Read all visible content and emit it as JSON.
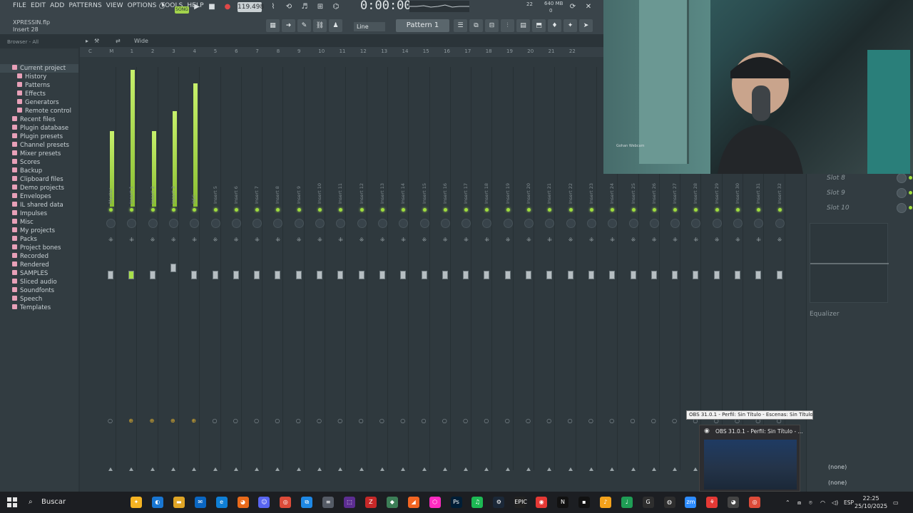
{
  "menu": [
    "FILE",
    "EDIT",
    "ADD",
    "PATTERNS",
    "VIEW",
    "OPTIONS",
    "TOOLS",
    "HELP"
  ],
  "transport": {
    "mode": "SONG",
    "tempo": "119.498",
    "time": "0:00:00",
    "cpu_label": "22",
    "memory": "640 MB",
    "memory_sub": "0"
  },
  "hint": {
    "file": "XPRESSIN.flp",
    "target": "Insert 28"
  },
  "toolbar": {
    "snap": "Line",
    "pattern": "Pattern 1"
  },
  "browser": {
    "header": "Browser - All",
    "items": [
      {
        "label": "Current project",
        "level": 0,
        "color": "#e8a0b8"
      },
      {
        "label": "History",
        "level": 1,
        "color": "#e8a0b8"
      },
      {
        "label": "Patterns",
        "level": 1,
        "color": "#e8a0b8"
      },
      {
        "label": "Effects",
        "level": 1,
        "color": "#e8a0b8"
      },
      {
        "label": "Generators",
        "level": 1,
        "color": "#e8a0b8"
      },
      {
        "label": "Remote control",
        "level": 1,
        "color": "#e8a0b8"
      },
      {
        "label": "Recent files",
        "level": 0,
        "color": "#e8a0b8"
      },
      {
        "label": "Plugin database",
        "level": 0,
        "color": "#e8a0b8"
      },
      {
        "label": "Plugin presets",
        "level": 0,
        "color": "#e8a0b8"
      },
      {
        "label": "Channel presets",
        "level": 0,
        "color": "#e8a0b8"
      },
      {
        "label": "Mixer presets",
        "level": 0,
        "color": "#e8a0b8"
      },
      {
        "label": "Scores",
        "level": 0,
        "color": "#e8a0b8"
      },
      {
        "label": "Backup",
        "level": 0,
        "color": "#e8a0b8"
      },
      {
        "label": "Clipboard files",
        "level": 0,
        "color": "#e8a0b8"
      },
      {
        "label": "Demo projects",
        "level": 0,
        "color": "#e8a0b8"
      },
      {
        "label": "Envelopes",
        "level": 0,
        "color": "#e8a0b8"
      },
      {
        "label": "IL shared data",
        "level": 0,
        "color": "#e8a0b8"
      },
      {
        "label": "Impulses",
        "level": 0,
        "color": "#e8a0b8"
      },
      {
        "label": "Misc",
        "level": 0,
        "color": "#e8a0b8"
      },
      {
        "label": "My projects",
        "level": 0,
        "color": "#e8a0b8"
      },
      {
        "label": "Packs",
        "level": 0,
        "color": "#e8a0b8"
      },
      {
        "label": "Project bones",
        "level": 0,
        "color": "#e8a0b8"
      },
      {
        "label": "Recorded",
        "level": 0,
        "color": "#e8a0b8"
      },
      {
        "label": "Rendered",
        "level": 0,
        "color": "#e8a0b8"
      },
      {
        "label": "SAMPLES",
        "level": 0,
        "color": "#e8a0b8"
      },
      {
        "label": "Sliced audio",
        "level": 0,
        "color": "#e8a0b8"
      },
      {
        "label": "Soundfonts",
        "level": 0,
        "color": "#e8a0b8"
      },
      {
        "label": "Speech",
        "level": 0,
        "color": "#e8a0b8"
      },
      {
        "label": "Templates",
        "level": 0,
        "color": "#e8a0b8"
      }
    ]
  },
  "mixer": {
    "view": "Wide",
    "ruler": [
      "C",
      "M",
      "1",
      "2",
      "3",
      "4",
      "5",
      "6",
      "7",
      "8",
      "9",
      "10",
      "11",
      "12",
      "13",
      "14",
      "15",
      "16",
      "17",
      "18",
      "19",
      "20",
      "21",
      "22"
    ],
    "tracks": [
      "Master",
      "Insert 1",
      "Insert 2",
      "Insert 3",
      "REC",
      "Insert 5",
      "Insert 6",
      "Insert 7",
      "Insert 8",
      "Insert 9",
      "Insert 10",
      "Insert 11",
      "Insert 12",
      "Insert 13",
      "Insert 14",
      "Insert 15",
      "Insert 16",
      "Insert 17",
      "Insert 18",
      "Insert 19",
      "Insert 20",
      "Insert 21",
      "Insert 22",
      "Insert 23",
      "Insert 24",
      "Insert 25",
      "Insert 26",
      "Insert 27",
      "Insert 28",
      "Insert 29",
      "Insert 30",
      "Insert 31",
      "Insert 32"
    ],
    "meter_levels": [
      0.55,
      1.0,
      0.55,
      0.7,
      0.9,
      0,
      0,
      0,
      0,
      0,
      0,
      0,
      0,
      0,
      0,
      0,
      0,
      0,
      0,
      0,
      0,
      0,
      0,
      0,
      0,
      0,
      0,
      0,
      0,
      0,
      0,
      0,
      0
    ]
  },
  "fx": {
    "slots": [
      "Slot 8",
      "Slot 9",
      "Slot 10"
    ],
    "equalizer": "Equalizer",
    "none1": "(none)",
    "none2": "(none)"
  },
  "webcam": {
    "logo": "Gohan Webcam"
  },
  "obs": {
    "tooltip": "OBS 31.0.1 - Perfil: Sin Título - Escenas: Sin Título",
    "thumb_title": "OBS 31.0.1 - Perfil: Sin Título - ..."
  },
  "taskbar": {
    "search": "Buscar",
    "lang": "ESP",
    "time": "22:25",
    "date": "25/10/2025"
  }
}
